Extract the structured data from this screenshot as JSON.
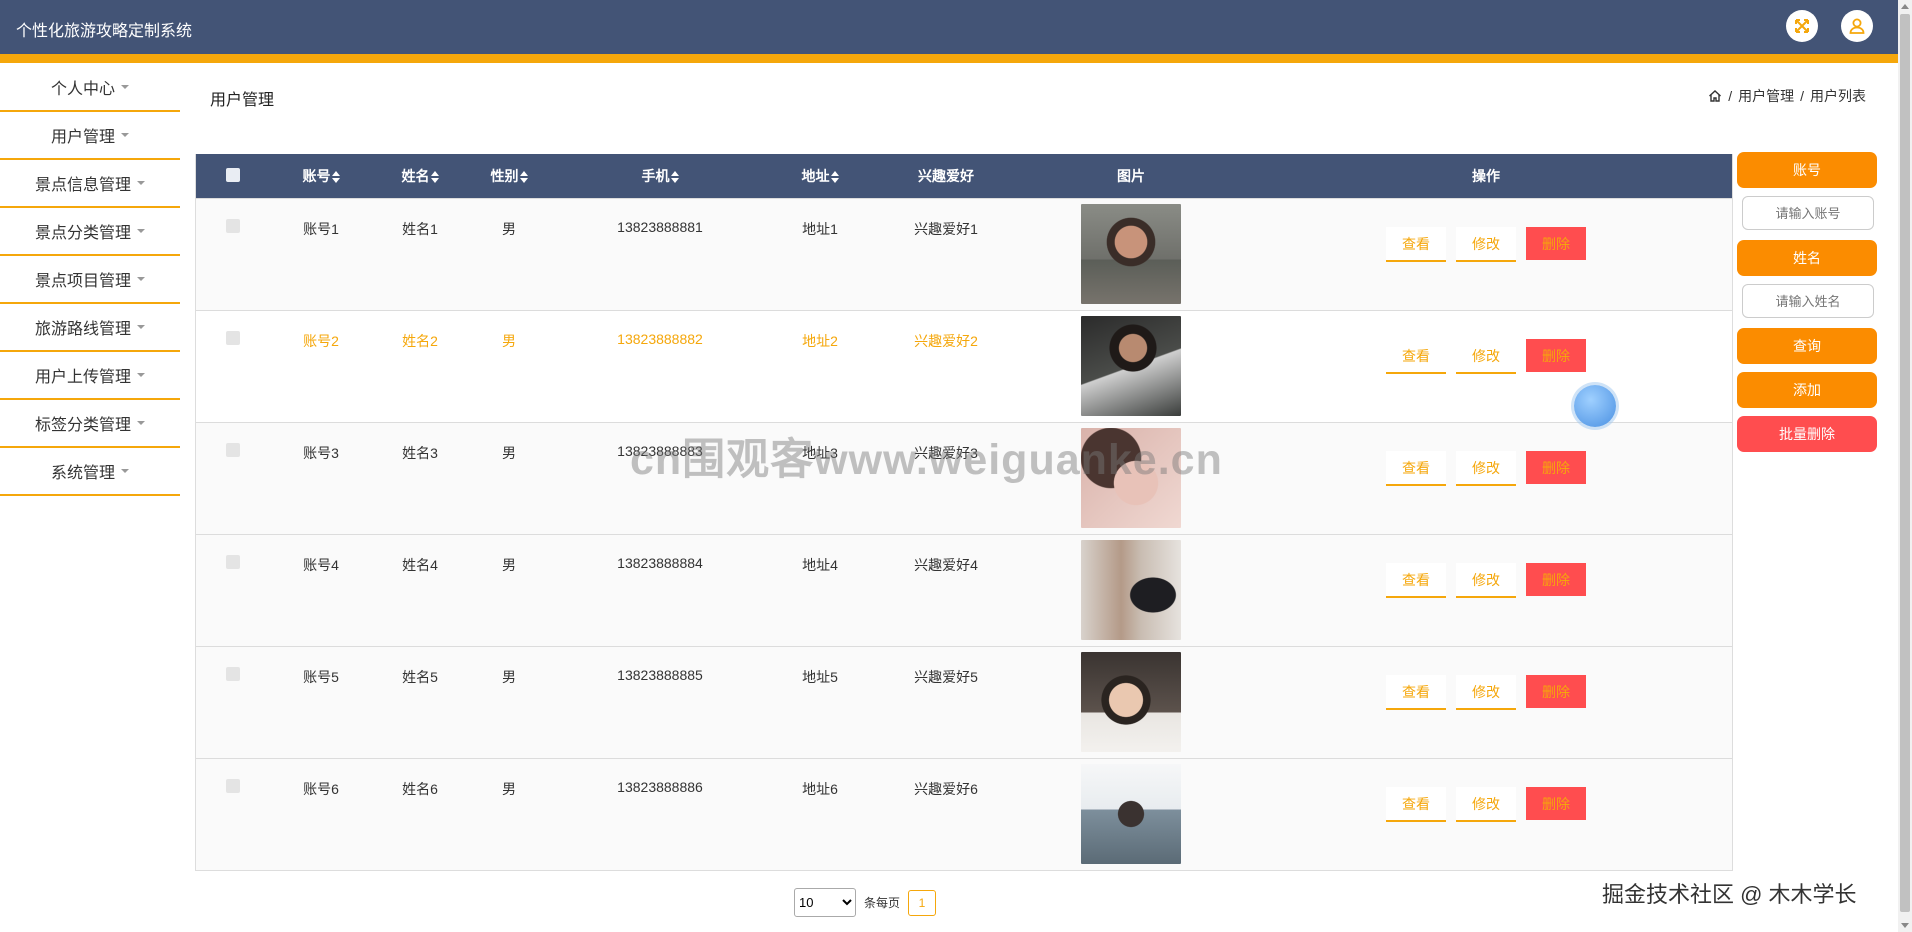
{
  "app": {
    "title": "个性化旅游攻略定制系统"
  },
  "header": {
    "fullscreen_icon": "expand-icon",
    "user_icon": "user-icon",
    "accent_color": "#f5a70b",
    "bar_color": "#435476"
  },
  "sidebar": {
    "items": [
      {
        "label": "个人中心"
      },
      {
        "label": "用户管理"
      },
      {
        "label": "景点信息管理"
      },
      {
        "label": "景点分类管理"
      },
      {
        "label": "景点项目管理"
      },
      {
        "label": "旅游路线管理"
      },
      {
        "label": "用户上传管理"
      },
      {
        "label": "标签分类管理"
      },
      {
        "label": "系统管理"
      }
    ]
  },
  "page": {
    "title": "用户管理",
    "breadcrumb": [
      "用户管理",
      "用户列表"
    ]
  },
  "table": {
    "headers": {
      "account": "账号",
      "name": "姓名",
      "sex": "性别",
      "phone": "手机",
      "address": "地址",
      "hobby": "兴趣爱好",
      "picture": "图片",
      "ops": "操作"
    },
    "rows": [
      {
        "account": "账号1",
        "name": "姓名1",
        "sex": "男",
        "phone": "13823888881",
        "address": "地址1",
        "hobby": "兴趣爱好1"
      },
      {
        "account": "账号2",
        "name": "姓名2",
        "sex": "男",
        "phone": "13823888882",
        "address": "地址2",
        "hobby": "兴趣爱好2"
      },
      {
        "account": "账号3",
        "name": "姓名3",
        "sex": "男",
        "phone": "13823888883",
        "address": "地址3",
        "hobby": "兴趣爱好3"
      },
      {
        "account": "账号4",
        "name": "姓名4",
        "sex": "男",
        "phone": "13823888884",
        "address": "地址4",
        "hobby": "兴趣爱好4"
      },
      {
        "account": "账号5",
        "name": "姓名5",
        "sex": "男",
        "phone": "13823888885",
        "address": "地址5",
        "hobby": "兴趣爱好5"
      },
      {
        "account": "账号6",
        "name": "姓名6",
        "sex": "男",
        "phone": "13823888886",
        "address": "地址6",
        "hobby": "兴趣爱好6"
      }
    ],
    "actions": {
      "view": "查看",
      "edit": "修改",
      "delete": "删除"
    }
  },
  "search_panel": {
    "account_label": "账号",
    "account_placeholder": "请输入账号",
    "name_label": "姓名",
    "name_placeholder": "请输入姓名",
    "query_button": "查询",
    "add_button": "添加",
    "batch_delete_button": "批量删除"
  },
  "pagination": {
    "page_size": "10",
    "per_page_label": "条每页",
    "current_page": "1"
  },
  "watermarks": {
    "center": "cn围观客www.weiguanke.cn",
    "corner": "掘金技术社区 @ 木木学长"
  }
}
